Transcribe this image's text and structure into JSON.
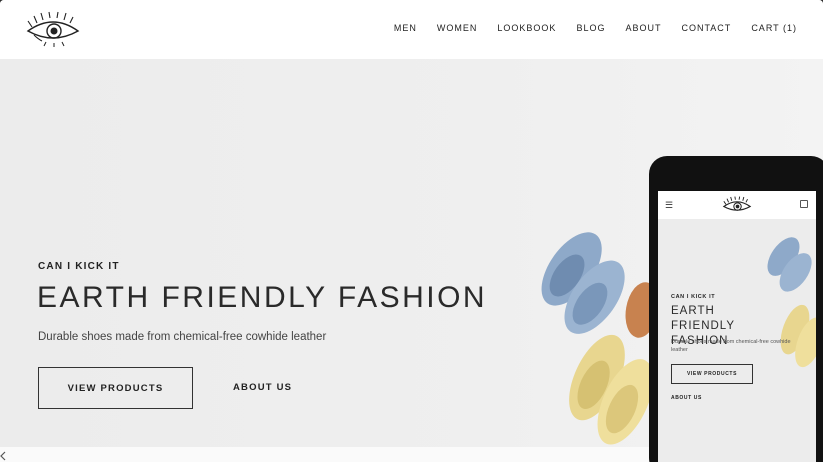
{
  "nav": {
    "items": [
      "MEN",
      "WOMEN",
      "LOOKBOOK",
      "BLOG",
      "ABOUT",
      "CONTACT",
      "CART (1)"
    ]
  },
  "logo": {
    "icon": "eye-logo-icon"
  },
  "hero": {
    "eyebrow": "CAN I KICK IT",
    "headline": "EARTH FRIENDLY FASHION",
    "subline": "Durable shoes made from chemical-free cowhide leather",
    "primary_button": "VIEW PRODUCTS",
    "secondary_link": "ABOUT US"
  },
  "mobile": {
    "menu_icon": "hamburger-icon",
    "cart_icon": "cart-icon",
    "eyebrow": "CAN I KICK IT",
    "headline": "EARTH FRIENDLY FASHION",
    "subline": "Durable shoes made from chemical-free cowhide leather",
    "primary_button": "VIEW PRODUCTS",
    "secondary_link": "ABOUT US"
  },
  "colors": {
    "background": "#ececec",
    "text": "#2a2a2a",
    "shoe_blue": "#8ea9c9",
    "shoe_yellow": "#e8d68f",
    "shoe_tan": "#c8824f"
  }
}
